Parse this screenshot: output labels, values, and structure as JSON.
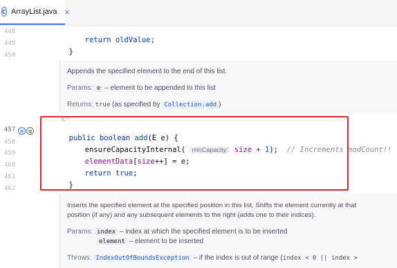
{
  "tab": {
    "icon_letter": "C",
    "file_name": "ArrayList.java",
    "close_glyph": "×"
  },
  "gutter": {
    "lines": [
      "448",
      "449",
      "450",
      "457",
      "458",
      "459",
      "460",
      "461",
      "462"
    ]
  },
  "code": {
    "line_448": "return oldValue;",
    "line_449": "}",
    "line_457_kw": "public boolean",
    "line_457_fn": "add",
    "line_457_rest": "(E e) {",
    "line_458_fn": "ensureCapacityInternal(",
    "line_458_hint": "minCapacity:",
    "line_458_arg": "size + ",
    "line_458_num": "1",
    "line_458_end": ");",
    "line_458_comment": "// Increments modCount!!",
    "line_459_field": "elementData",
    "line_459_idx": "[",
    "line_459_size": "size",
    "line_459_rest": "++] = e;",
    "line_460_kw": "return true",
    "line_460_end": ";",
    "line_461": "}"
  },
  "doc1": {
    "description": "Appends the specified element to the end of this list.",
    "params_label": "Params:",
    "param_name": "e",
    "param_desc": "– element to be appended to this list",
    "returns_label": "Returns:",
    "returns_value": "true",
    "returns_desc": "(as specified by",
    "returns_link": "Collection.add",
    "returns_close": ")"
  },
  "doc2": {
    "description_line1": "Inserts the specified element at the specified position in this list. Shifts the element currently at that",
    "description_line2": "position (if any) and any subsequent elements to the right (adds one to their indices).",
    "params_label": "Params:",
    "param1_name": "index",
    "param1_desc": "– index at which the specified element is to be inserted",
    "param2_name": "element",
    "param2_desc": "– element to be inserted",
    "throws_label": "Throws:",
    "throws_link": "IndexOutOfBoundsException",
    "throws_desc": "– if the index is out of range (",
    "throws_code": "index < 0 || index >"
  },
  "colors": {
    "highlight_border": "#e0262b",
    "keyword": "#0033b3",
    "field": "#871094",
    "tab_accent": "#3574f0"
  }
}
